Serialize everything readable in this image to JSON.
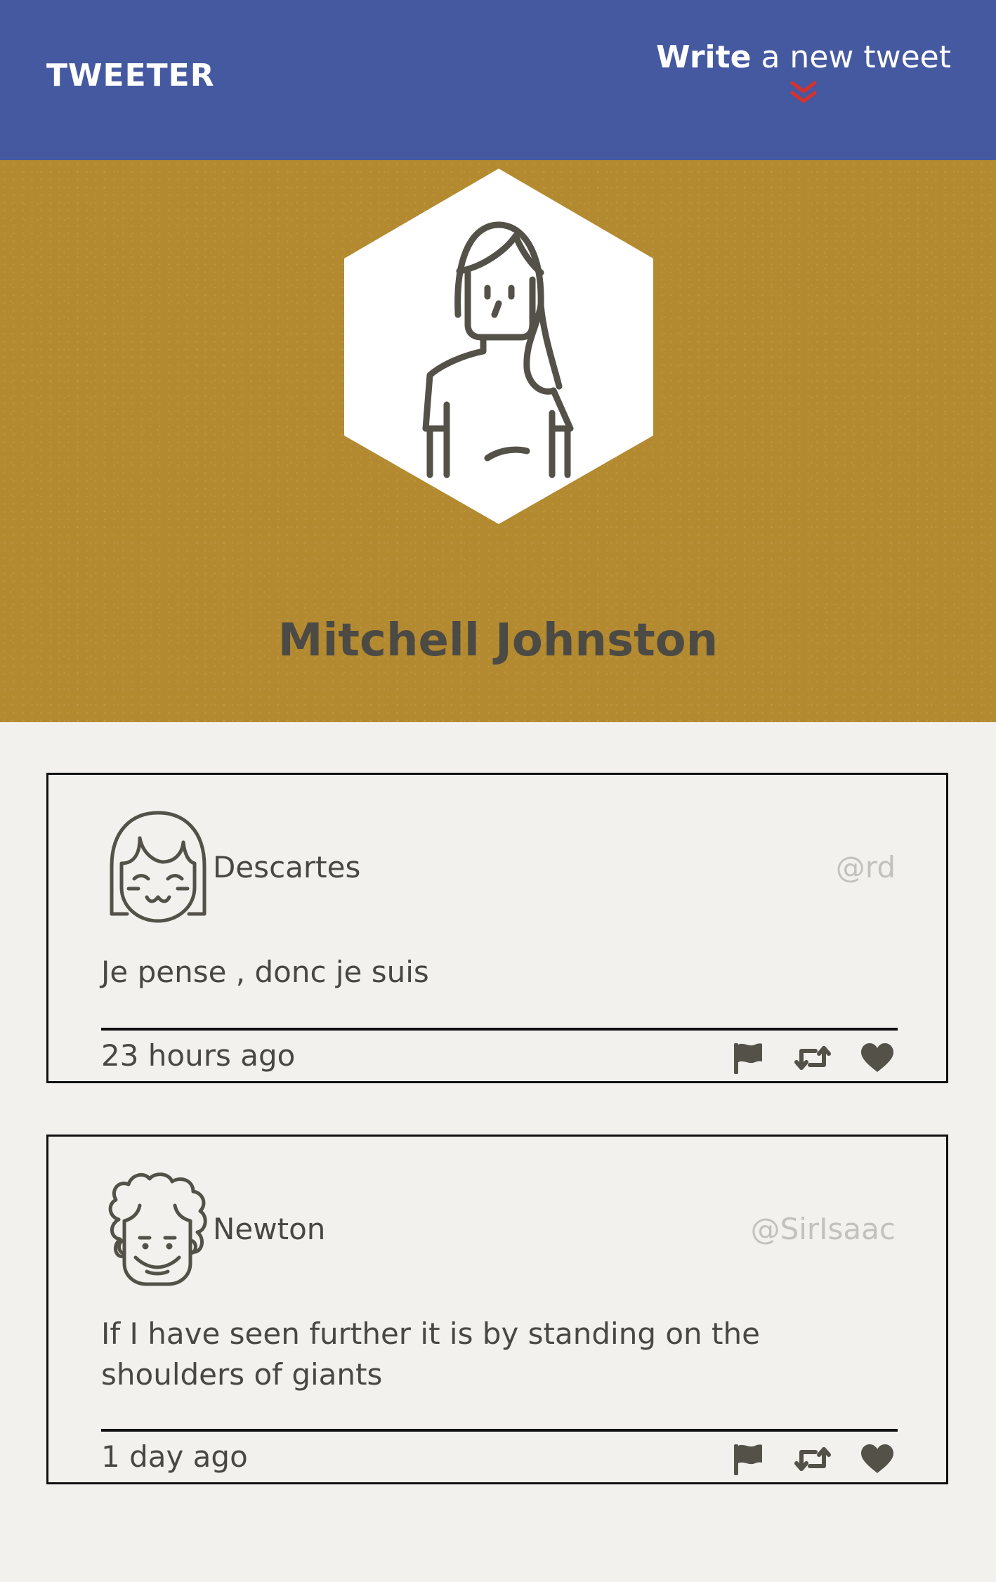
{
  "header": {
    "brand": "TWEETER",
    "compose_strong": "Write",
    "compose_rest": " a new tweet",
    "chevron_color": "#d8312c"
  },
  "profile": {
    "name": "Mitchell Johnston",
    "banner_color": "#b38a30",
    "avatar": "woman-avatar-icon"
  },
  "tweets": [
    {
      "author": "Descartes",
      "handle": "@rd",
      "text": "Je pense , donc je suis",
      "time": "23 hours ago",
      "avatar": "girl-bangs-avatar-icon",
      "actions": [
        "flag-icon",
        "retweet-icon",
        "heart-icon"
      ]
    },
    {
      "author": "Newton",
      "handle": "@SirIsaac",
      "text": "If I have seen further it is by standing on the shoulders of giants",
      "time": "1 day ago",
      "avatar": "curly-hair-avatar-icon",
      "actions": [
        "flag-icon",
        "retweet-icon",
        "heart-icon"
      ]
    }
  ],
  "colors": {
    "topbar": "#4559a0",
    "page_bg": "#f2f1ee",
    "text": "#4a4743",
    "handle": "#c3c1bc",
    "icon": "#545149"
  }
}
